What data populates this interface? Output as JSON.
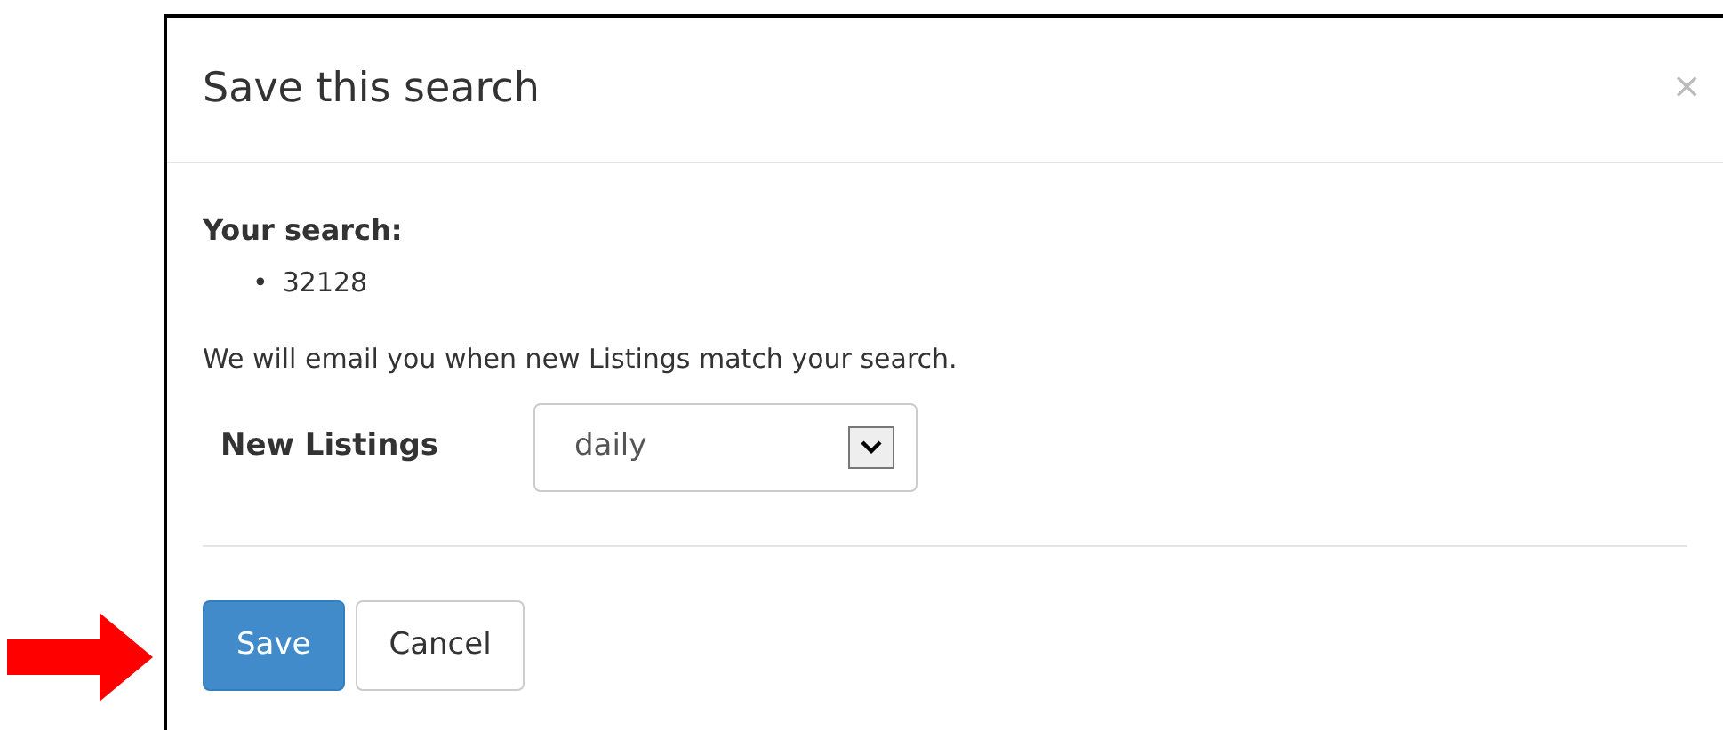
{
  "dialog": {
    "title": "Save this search",
    "close": "×"
  },
  "search_label": "Your search:",
  "terms": [
    {
      "bullet": "•",
      "text": "32128"
    }
  ],
  "notice": "We will email you when new Listings match your search.",
  "frequency": {
    "label": "New Listings",
    "value": "daily"
  },
  "buttons": [
    {
      "label": "Save",
      "kind": "primary"
    },
    {
      "label": "Cancel",
      "kind": "default"
    }
  ]
}
